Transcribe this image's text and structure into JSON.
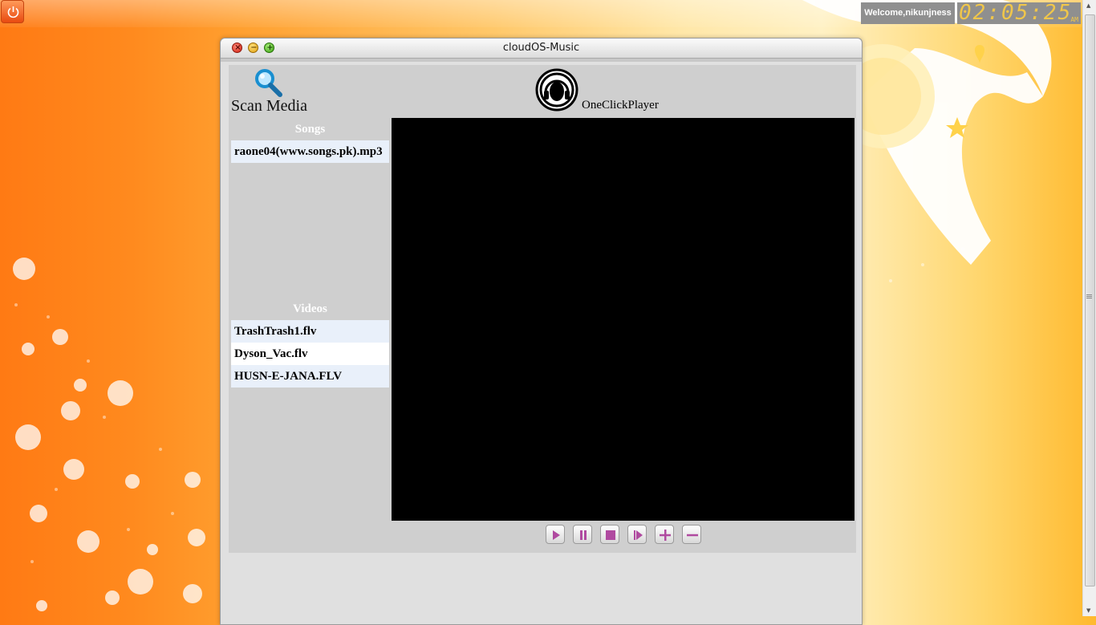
{
  "topbar": {
    "welcome": "Welcome,nikunjness",
    "clock": {
      "time": "02:05:25",
      "ampm": "AM"
    }
  },
  "window": {
    "title": "cloudOS-Music",
    "scan_label": "Scan Media",
    "player_name": "OneClickPlayer",
    "songs_title": "Songs",
    "songs": [
      "raone04(www.songs.pk).mp3"
    ],
    "videos_title": "Videos",
    "videos": [
      "TrashTrash1.flv",
      "Dyson_Vac.flv",
      "HUSN-E-JANA.FLV"
    ],
    "controls": [
      "play-icon",
      "pause-icon",
      "stop-icon",
      "next-icon",
      "volume-up-icon",
      "volume-down-icon"
    ]
  },
  "colors": {
    "accent": "#b04aa0",
    "desktop": "#ff8a1e",
    "video_bg": "#000000"
  }
}
